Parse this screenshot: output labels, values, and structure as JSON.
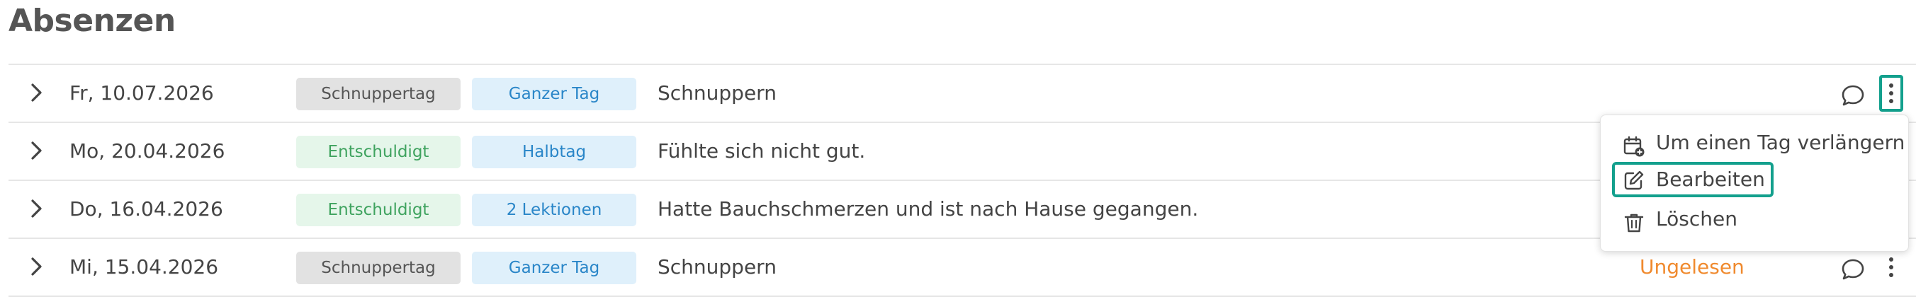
{
  "page": {
    "title": "Absenzen"
  },
  "absences": [
    {
      "date": "Fr, 10.07.2026",
      "type": "Schnuppertag",
      "type_variant": "gray",
      "duration": "Ganzer Tag",
      "comment": "Schnuppern",
      "status": ""
    },
    {
      "date": "Mo, 20.04.2026",
      "type": "Entschuldigt",
      "type_variant": "green",
      "duration": "Halbtag",
      "comment": "Fühlte sich nicht gut.",
      "status": ""
    },
    {
      "date": "Do, 16.04.2026",
      "type": "Entschuldigt",
      "type_variant": "green",
      "duration": "2 Lektionen",
      "comment": "Hatte Bauchschmerzen und ist nach Hause gegangen.",
      "status": ""
    },
    {
      "date": "Mi, 15.04.2026",
      "type": "Schnuppertag",
      "type_variant": "gray",
      "duration": "Ganzer Tag",
      "comment": "Schnuppern",
      "status": "Ungelesen"
    }
  ],
  "context_menu": {
    "items": [
      {
        "label": "Um einen Tag verlängern",
        "icon": "calendar-plus-icon"
      },
      {
        "label": "Bearbeiten",
        "icon": "edit-icon"
      },
      {
        "label": "Löschen",
        "icon": "trash-icon"
      }
    ]
  },
  "colors": {
    "accent": "#13a08d",
    "status_unread": "#f08a2e",
    "badge_gray_bg": "#e2e2e2",
    "badge_green_bg": "#e5f6ea",
    "badge_green_text": "#3fa35f",
    "badge_blue_bg": "#dff0fb",
    "badge_blue_text": "#2a86c8"
  }
}
